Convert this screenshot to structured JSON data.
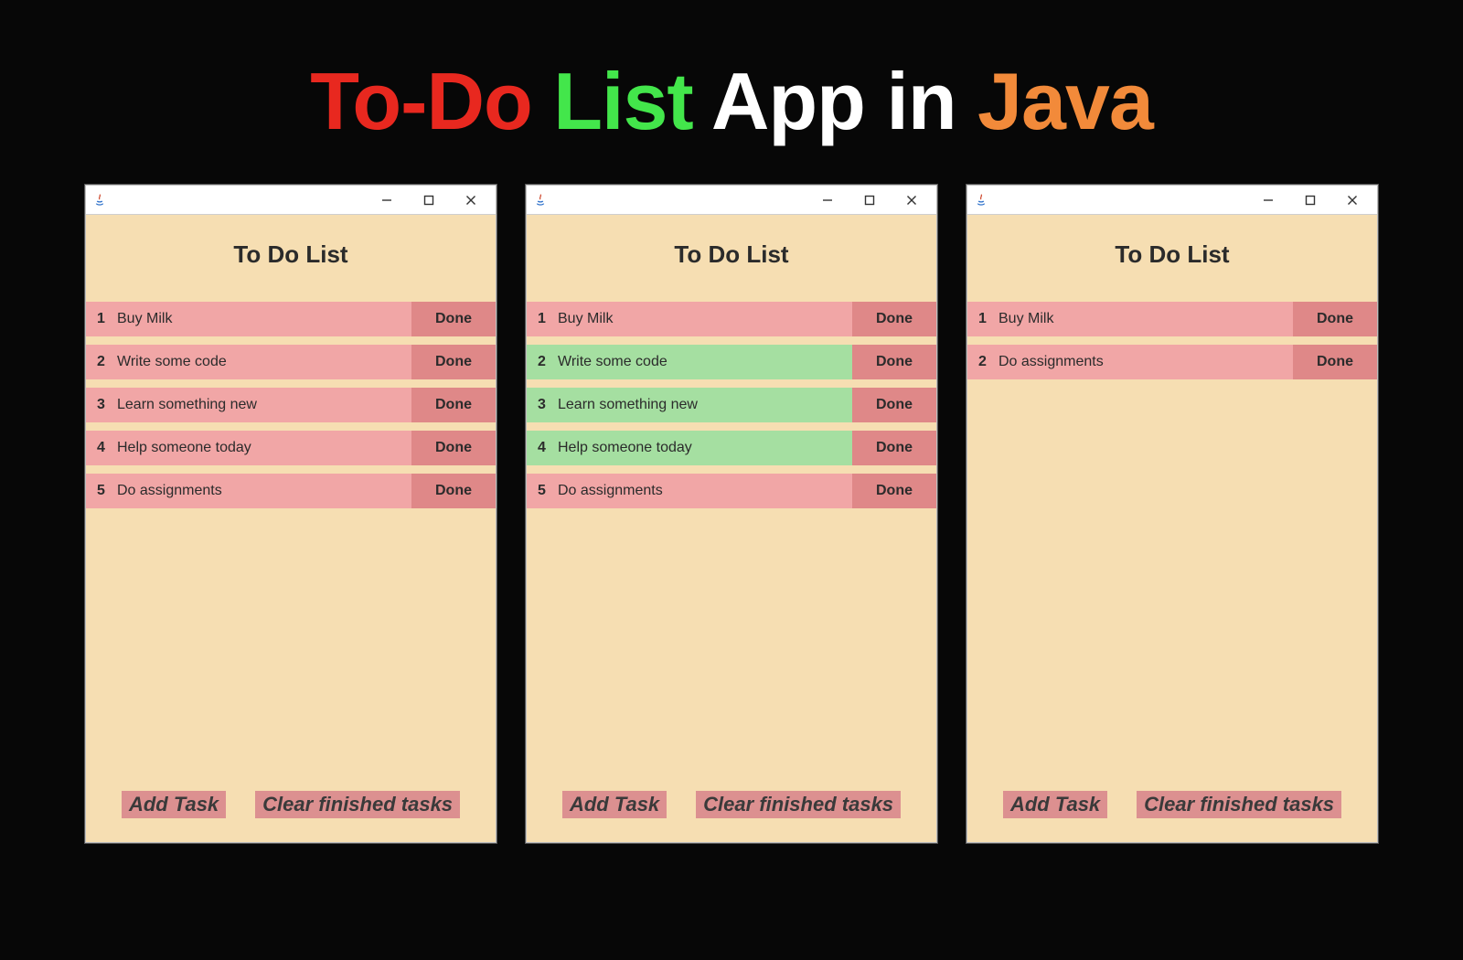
{
  "headline": {
    "w1": "To-Do",
    "w2": "List",
    "w3": "App in",
    "w4": "Java"
  },
  "colors": {
    "task_pink": "#f1a6a6",
    "task_green": "#a5dfa1",
    "done_btn": "#df8888",
    "footer_btn": "#dc9090",
    "body_bg": "#f6deb2"
  },
  "common": {
    "app_title": "To Do List",
    "done_label": "Done",
    "add_label": "Add Task",
    "clear_label": "Clear finished tasks"
  },
  "windows": [
    {
      "tasks": [
        {
          "num": "1",
          "text": "Buy Milk",
          "state": "pink"
        },
        {
          "num": "2",
          "text": "Write some code",
          "state": "pink"
        },
        {
          "num": "3",
          "text": "Learn something new",
          "state": "pink"
        },
        {
          "num": "4",
          "text": "Help someone today",
          "state": "pink"
        },
        {
          "num": "5",
          "text": "Do assignments",
          "state": "pink"
        }
      ]
    },
    {
      "tasks": [
        {
          "num": "1",
          "text": "Buy Milk",
          "state": "pink"
        },
        {
          "num": "2",
          "text": "Write some code",
          "state": "green"
        },
        {
          "num": "3",
          "text": "Learn something new",
          "state": "green"
        },
        {
          "num": "4",
          "text": "Help someone today",
          "state": "green"
        },
        {
          "num": "5",
          "text": "Do assignments",
          "state": "pink"
        }
      ]
    },
    {
      "tasks": [
        {
          "num": "1",
          "text": "Buy Milk",
          "state": "pink"
        },
        {
          "num": "2",
          "text": "Do assignments",
          "state": "pink"
        }
      ]
    }
  ]
}
